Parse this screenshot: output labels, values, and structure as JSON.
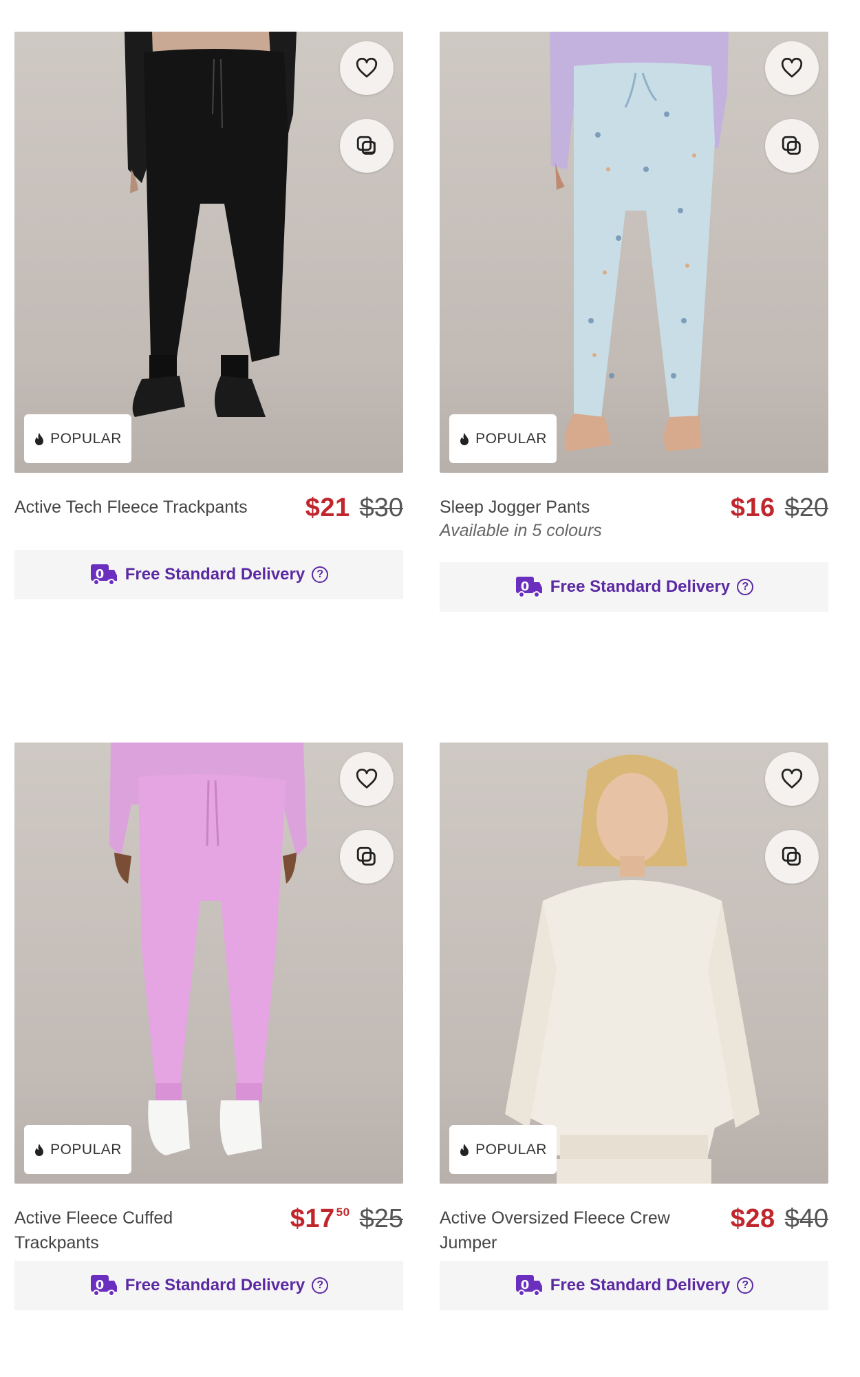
{
  "products": [
    {
      "name": "Active Tech Fleece Trackpants",
      "price_now": "$21",
      "price_now_cents": "",
      "price_was": "$30",
      "badge": "POPULAR",
      "colours_text": "",
      "delivery": "Free Standard Delivery",
      "garment_color": "#141414"
    },
    {
      "name": "Sleep Jogger Pants",
      "price_now": "$16",
      "price_now_cents": "",
      "price_was": "$20",
      "badge": "POPULAR",
      "colours_text": "Available in 5 colours",
      "delivery": "Free Standard Delivery",
      "garment_color": "#c9dde6"
    },
    {
      "name": "Active Fleece Cuffed Trackpants",
      "price_now": "$17",
      "price_now_cents": "50",
      "price_was": "$25",
      "badge": "POPULAR",
      "colours_text": "",
      "delivery": "Free Standard Delivery",
      "garment_color": "#e5a4e2"
    },
    {
      "name": "Active Oversized Fleece Crew Jumper",
      "price_now": "$28",
      "price_now_cents": "",
      "price_was": "$40",
      "badge": "POPULAR",
      "colours_text": "",
      "delivery": "Free Standard Delivery",
      "garment_color": "#f1ece3"
    }
  ],
  "icons": {
    "favourite": "heart-icon",
    "compare": "compare-icon",
    "badge": "flame-icon",
    "delivery": "delivery-truck-icon",
    "help": "help-icon"
  },
  "colors": {
    "sale_price": "#c0272d",
    "delivery_purple": "#5b2aa3",
    "delivery_bg": "#f6f5f5"
  },
  "help_glyph": "?"
}
